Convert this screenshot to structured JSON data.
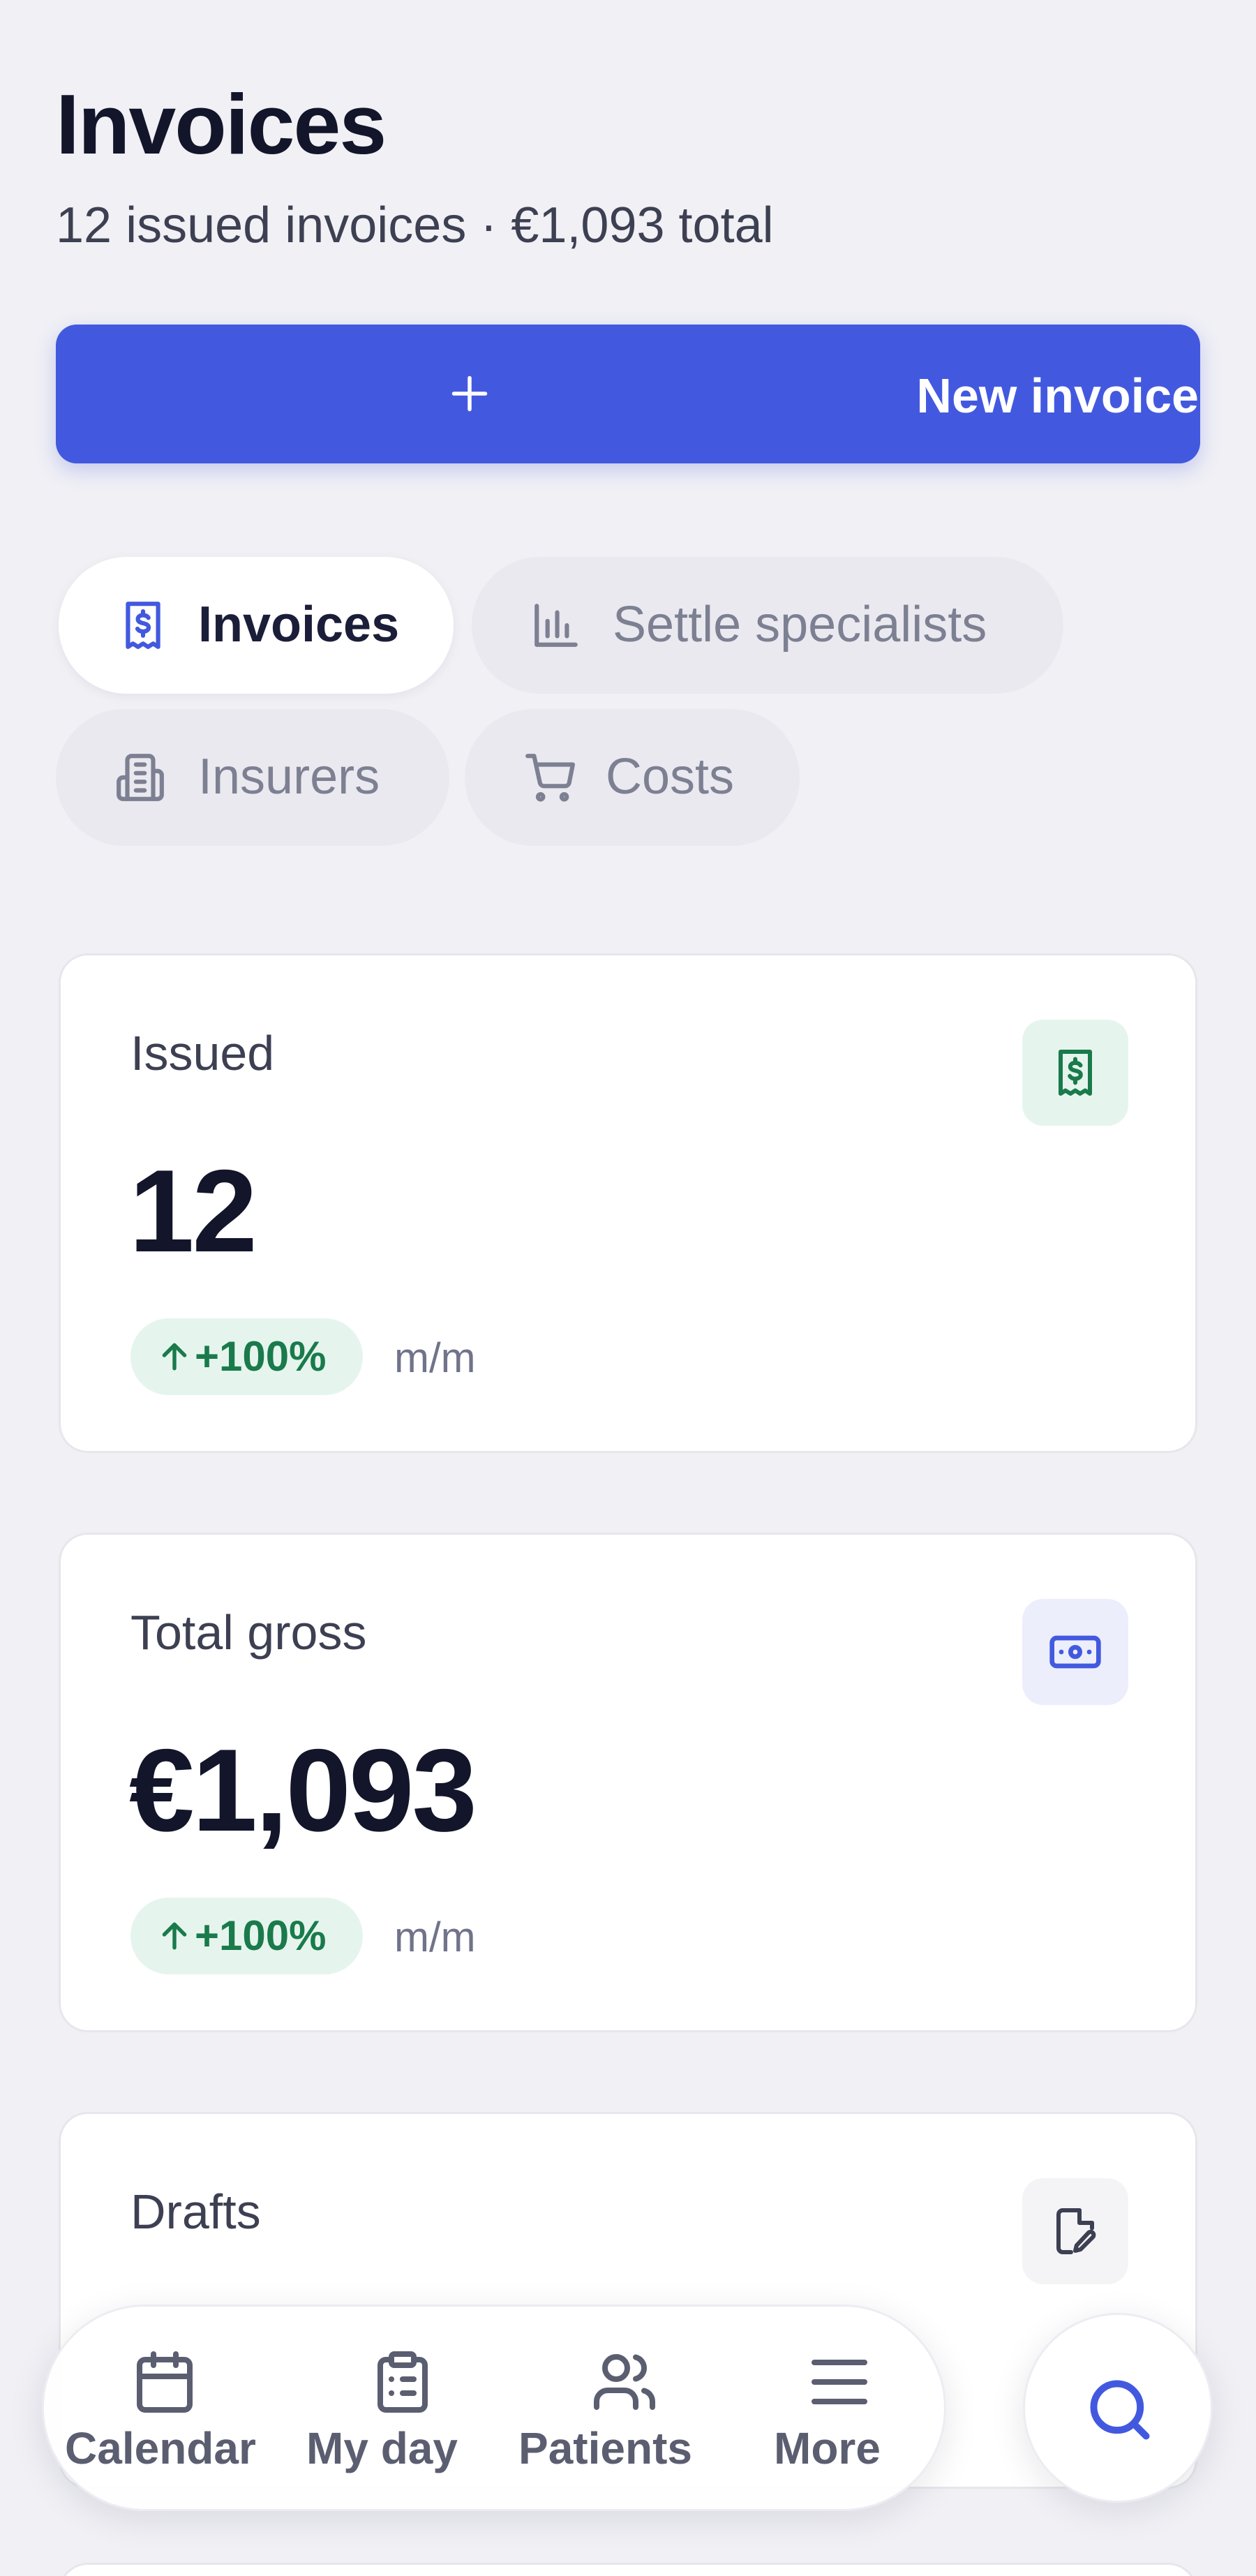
{
  "header": {
    "title": "Invoices",
    "subtitle": "12 issued invoices · €1,093 total"
  },
  "new_invoice": {
    "label": "New invoice",
    "icon": "plus-icon"
  },
  "tabs": [
    {
      "label": "Invoices",
      "icon": "receipt-icon",
      "active": true
    },
    {
      "label": "Settle specialists",
      "icon": "bar-chart-icon",
      "active": false
    },
    {
      "label": "Insurers",
      "icon": "building-icon",
      "active": false
    },
    {
      "label": "Costs",
      "icon": "cart-icon",
      "active": false
    }
  ],
  "cards": [
    {
      "label": "Issued",
      "value": "12",
      "change": "+100%",
      "period": "m/m",
      "icon": "receipt-icon",
      "icon_color": "#1a7a4c",
      "icon_bg": "#e5f5ed"
    },
    {
      "label": "Total gross",
      "value": "€1,093",
      "change": "+100%",
      "period": "m/m",
      "icon": "banknote-icon",
      "icon_color": "#4259df",
      "icon_bg": "#eceefc"
    },
    {
      "label": "Drafts",
      "icon": "file-edit-icon",
      "icon_color": "#3d4052",
      "icon_bg": "#f4f4f7"
    }
  ],
  "bottom_nav": {
    "items": [
      {
        "label": "Calendar",
        "icon": "calendar-icon"
      },
      {
        "label": "My day",
        "icon": "clipboard-icon"
      },
      {
        "label": "Patients",
        "icon": "users-icon"
      },
      {
        "label": "More",
        "icon": "menu-icon"
      }
    ],
    "search_icon": "search-icon"
  },
  "colors": {
    "accent": "#4259df",
    "positive": "#1a7a4c",
    "background": "#f0f0f5"
  }
}
